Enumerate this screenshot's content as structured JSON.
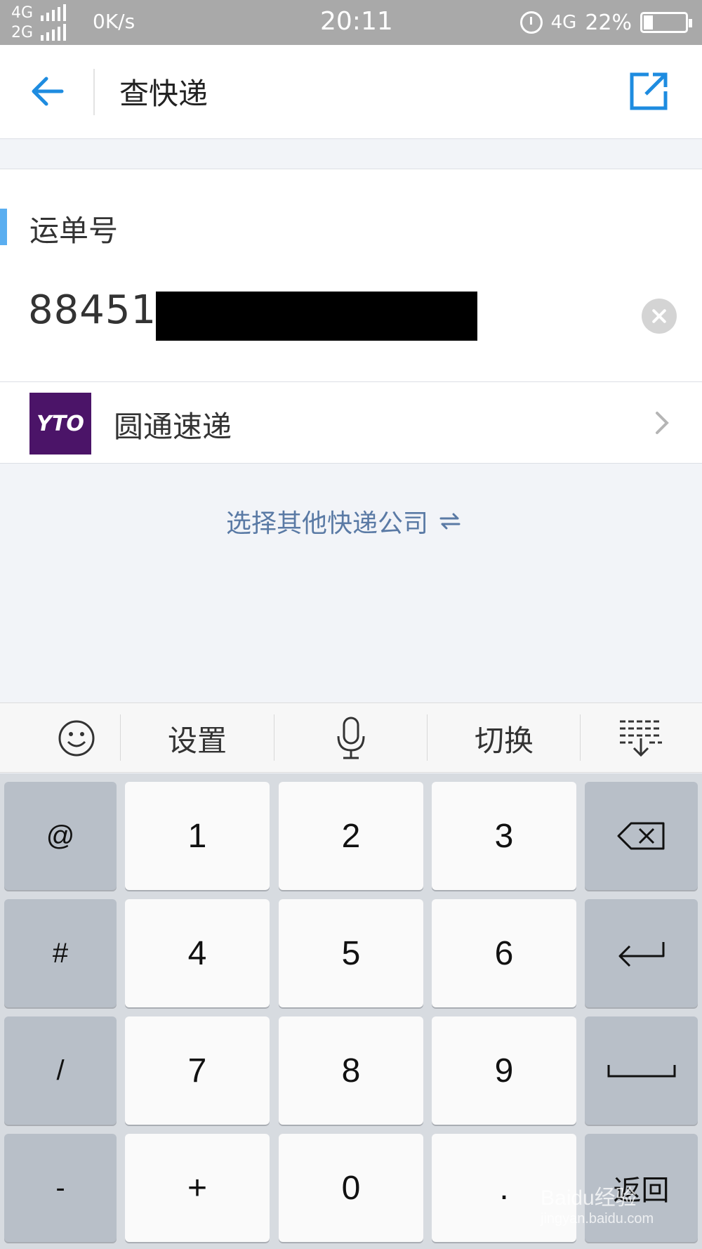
{
  "status_bar": {
    "net1": "4G",
    "net2": "2G",
    "speed": "0K/s",
    "time": "20:11",
    "net_type": "4G",
    "battery": "22%"
  },
  "header": {
    "title": "查快递"
  },
  "waybill": {
    "label": "运单号",
    "value": "884519"
  },
  "company": {
    "logo_text": "YTO",
    "name": "圆通速递"
  },
  "other_company_link": "选择其他快递公司",
  "keyboard_toolbar": {
    "settings": "设置",
    "switch": "切换"
  },
  "keys": {
    "r1": [
      "@",
      "1",
      "2",
      "3"
    ],
    "r2": [
      "#",
      "4",
      "5",
      "6"
    ],
    "r3": [
      "/",
      "7",
      "8",
      "9"
    ],
    "r4": [
      "-",
      "+",
      "0",
      ".",
      "返回"
    ]
  },
  "watermark": {
    "brand": "Baidu经验",
    "url": "jingyan.baidu.com"
  },
  "colors": {
    "accent": "#5aaef0",
    "header_icon": "#1e8ce0",
    "link": "#5a7aa5",
    "logo_bg": "#4b1468"
  }
}
